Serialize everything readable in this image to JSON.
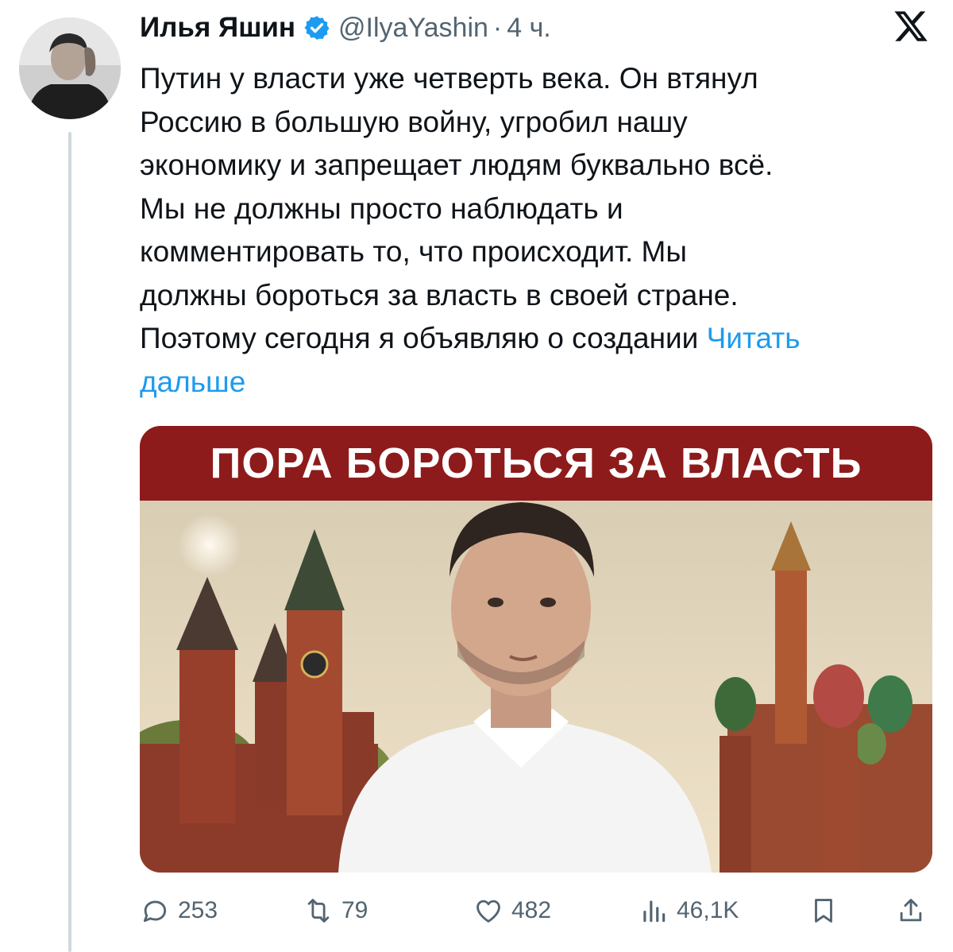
{
  "author": {
    "name": "Илья Яшин",
    "handle": "@IlyaYashin",
    "separator": "·",
    "time": "4 ч.",
    "verified": true,
    "avatar_icon": "profile-photo"
  },
  "tweet": {
    "text": "Путин у власти уже четверть века. Он втянул\nРоссию в большую войну, угробил нашу\nэкономику и запрещает людям буквально всё.\nМы не должны просто наблюдать и\nкомментировать то, что происходит. Мы\nдолжны бороться за власть в своей стране.\nПоэтому сегодня я объявляю о создании ",
    "read_more": "Читать\nдальше"
  },
  "media": {
    "banner_text": "ПОРА БОРОТЬСЯ ЗА ВЛАСТЬ",
    "banner_color": "#8e1b1b"
  },
  "actions": {
    "replies": "253",
    "reposts": "79",
    "likes": "482",
    "views": "46,1K",
    "icons": [
      "reply-icon",
      "repost-icon",
      "like-icon",
      "views-icon",
      "bookmark-icon",
      "share-icon"
    ]
  },
  "colors": {
    "text": "#0f1419",
    "secondary": "#536471",
    "link": "#1d9bf0",
    "verified": "#1d9bf0"
  }
}
